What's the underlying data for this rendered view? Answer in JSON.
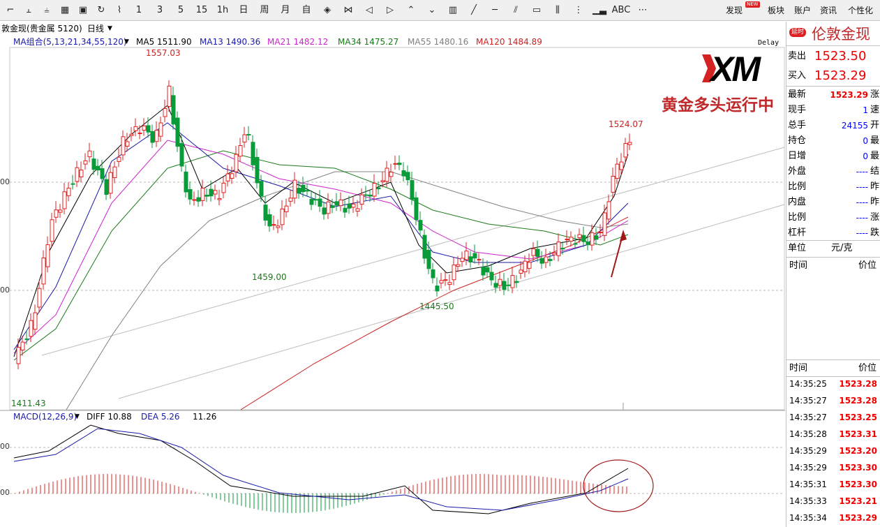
{
  "toolbar": {
    "icons": [
      {
        "name": "line-chart-icon",
        "glyph": "⌐"
      },
      {
        "name": "bar-tick-icon",
        "glyph": "⫠"
      },
      {
        "name": "candle-icon",
        "glyph": "⫨"
      },
      {
        "name": "board-icon",
        "glyph": "▦"
      },
      {
        "name": "save-icon",
        "glyph": "▣"
      },
      {
        "name": "refresh-icon",
        "glyph": "↻"
      },
      {
        "name": "draw-icon",
        "glyph": "⌇"
      }
    ],
    "periods": [
      "1",
      "3",
      "5",
      "15",
      "1h",
      "日",
      "周",
      "月",
      "自"
    ],
    "nav_icons": [
      {
        "name": "zoom-in-icon",
        "glyph": "◈"
      },
      {
        "name": "zoom-out-icon",
        "glyph": "⋈"
      },
      {
        "name": "left-arrow-icon",
        "glyph": "◁"
      },
      {
        "name": "right-arrow-icon",
        "glyph": "▷"
      },
      {
        "name": "up-icon",
        "glyph": "⌃"
      },
      {
        "name": "down-icon",
        "glyph": "⌄"
      },
      {
        "name": "layout-icon",
        "glyph": "▥"
      },
      {
        "name": "line-tool-icon",
        "glyph": "╱"
      },
      {
        "name": "hline-tool-icon",
        "glyph": "─"
      },
      {
        "name": "channel-tool-icon",
        "glyph": "⫽"
      },
      {
        "name": "rect-tool-icon",
        "glyph": "▭"
      },
      {
        "name": "vline-tool-icon",
        "glyph": "⫼"
      },
      {
        "name": "fib-tool-icon",
        "glyph": "⋮"
      },
      {
        "name": "bars-icon",
        "glyph": "▁▃"
      },
      {
        "name": "text-tool-icon",
        "glyph": "ABC"
      },
      {
        "name": "more-tools-icon",
        "glyph": "⋯"
      }
    ],
    "right_menu": [
      "发现",
      "板块",
      "账户",
      "资讯",
      "个性化"
    ],
    "new_badge": "NEW"
  },
  "title": {
    "symbol": "敦金现(贵金属 5120)",
    "period": "日线",
    "dropdown_icon": "chevron-down-icon"
  },
  "ma_legend": {
    "group": "MA组合(5,13,21,34,55,120)",
    "items": [
      {
        "label": "MA5 1511.90",
        "color": "#000000"
      },
      {
        "label": "MA13 1490.36",
        "color": "#1a1aa8"
      },
      {
        "label": "MA21 1482.12",
        "color": "#cc22cc"
      },
      {
        "label": "MA34 1475.27",
        "color": "#1a7a1a"
      },
      {
        "label": "MA55 1480.16",
        "color": "#808080"
      },
      {
        "label": "MA120 1484.89",
        "color": "#cc2222"
      }
    ],
    "delay": "Delay"
  },
  "price_labels": {
    "high": "1557.03",
    "low1": "1459.00",
    "low2": "1445.50",
    "last": "1524.07",
    "bottom": "1411.43",
    "left_500": "00",
    "left_450": "00"
  },
  "annotation": {
    "brand": "XM",
    "text": "黄金多头运行中"
  },
  "macd_legend": {
    "label": "MACD(12,26,9)",
    "diff": "DIFF 10.88",
    "dea": "DEA 5.26",
    "macd": "11.26",
    "left_top": "00",
    "left_mid": "00"
  },
  "quote": {
    "badge": "延时",
    "name": "伦敦金现",
    "sell_label": "卖出",
    "sell": "1523.50",
    "buy_label": "买入",
    "buy": "1523.29",
    "rows": [
      {
        "label": "最新",
        "value": "1523.29",
        "cls": "red",
        "extra": "涨"
      },
      {
        "label": "现手",
        "value": "1",
        "cls": "blue",
        "extra": "速"
      },
      {
        "label": "总手",
        "value": "24155",
        "cls": "blue",
        "extra": "开"
      },
      {
        "label": "持仓",
        "value": "0",
        "cls": "blue",
        "extra": "最"
      },
      {
        "label": "日增",
        "value": "0",
        "cls": "blue",
        "extra": "最"
      },
      {
        "label": "外盘",
        "value": "----",
        "cls": "blue",
        "extra": "结"
      },
      {
        "label": "比例",
        "value": "----",
        "cls": "blue",
        "extra": "昨"
      },
      {
        "label": "内盘",
        "value": "----",
        "cls": "blue",
        "extra": "昨"
      },
      {
        "label": "比例",
        "value": "----",
        "cls": "blue",
        "extra": "涨"
      },
      {
        "label": "杠杆",
        "value": "----",
        "cls": "blue",
        "extra": "跌"
      }
    ],
    "unit_label": "单位",
    "unit_value": "元/克",
    "time_header": "时间",
    "price_header": "价位"
  },
  "ticks": {
    "time_header": "时间",
    "price_header": "价位",
    "rows": [
      {
        "time": "14:35:25",
        "price": "1523.28"
      },
      {
        "time": "14:35:27",
        "price": "1523.28"
      },
      {
        "time": "14:35:27",
        "price": "1523.25"
      },
      {
        "time": "14:35:28",
        "price": "1523.31"
      },
      {
        "time": "14:35:29",
        "price": "1523.20"
      },
      {
        "time": "14:35:29",
        "price": "1523.30"
      },
      {
        "time": "14:35:31",
        "price": "1523.30"
      },
      {
        "time": "14:35:33",
        "price": "1523.21"
      },
      {
        "time": "14:35:34",
        "price": "1523.29"
      }
    ]
  },
  "colors": {
    "up": "#e02020",
    "down": "#0a9a3a",
    "ma120": "#cc2222",
    "ma5": "#000000",
    "ma13": "#1a1aa8",
    "ma21": "#cc22cc",
    "ma34": "#1a7a1a",
    "ma55": "#808080",
    "annotation": "#c0282a"
  }
}
